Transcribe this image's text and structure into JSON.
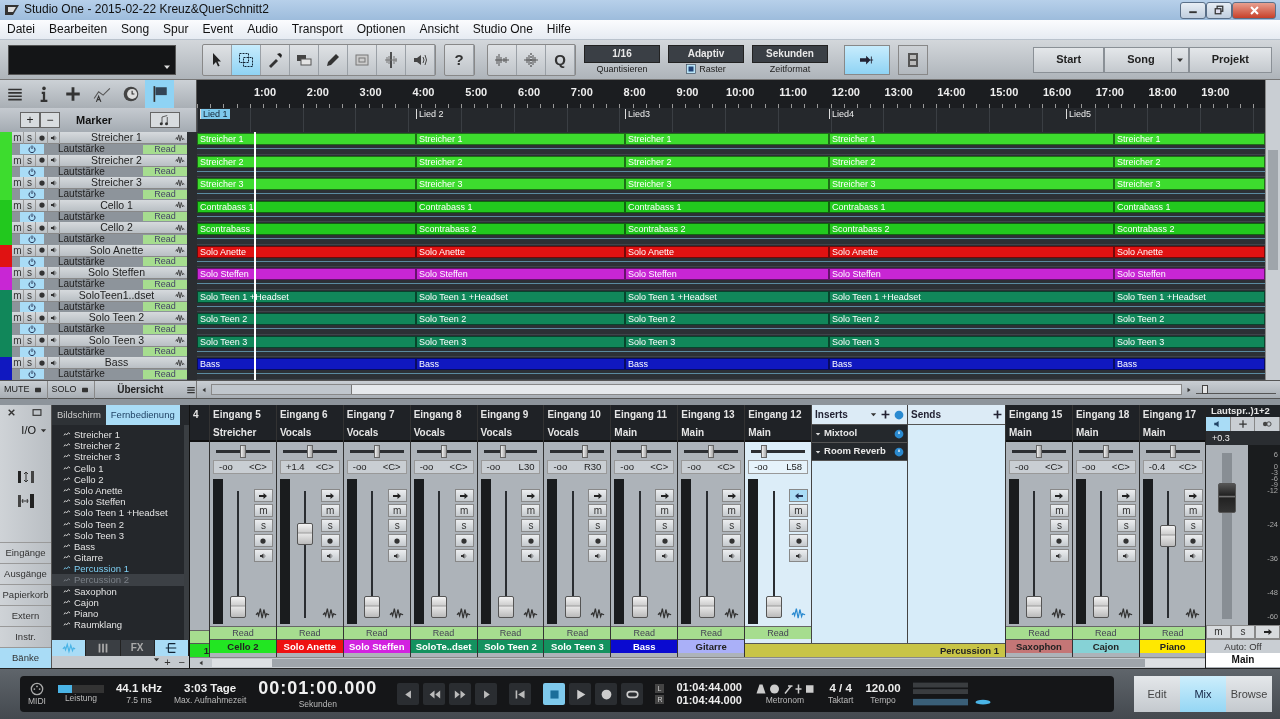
{
  "window": {
    "title": "Studio One - 2015-02-22 Kreuz&QuerSchnitt2"
  },
  "menu": [
    "Datei",
    "Bearbeiten",
    "Song",
    "Spur",
    "Event",
    "Audio",
    "Transport",
    "Optionen",
    "Ansicht",
    "Studio One",
    "Hilfe"
  ],
  "toolbar": {
    "tools": [
      {
        "kind": "pointer",
        "selected": false
      },
      {
        "kind": "range",
        "selected": true
      },
      {
        "kind": "dropper",
        "selected": false
      },
      {
        "kind": "blocks",
        "selected": false
      },
      {
        "kind": "pencil",
        "selected": false
      },
      {
        "kind": "mute",
        "selected": false
      },
      {
        "kind": "split",
        "selected": false
      },
      {
        "kind": "listen",
        "selected": false
      }
    ],
    "help": "?",
    "audio_tools": [
      {
        "kind": "bend"
      },
      {
        "kind": "detect"
      },
      {
        "kind": "text",
        "label": "Q"
      }
    ],
    "quantize": {
      "value": "1/16",
      "label": "Quantisieren"
    },
    "snap": {
      "value": "Adaptiv",
      "label": "Raster",
      "checked": true
    },
    "timeformat": {
      "value": "Sekunden",
      "label": "Zeitformat"
    },
    "follow": {
      "selected": true
    },
    "video": {
      "selected": false
    },
    "pages": [
      {
        "label": "Start",
        "dropdown": false
      },
      {
        "label": "Song",
        "dropdown": true
      },
      {
        "label": "Projekt",
        "dropdown": false
      }
    ]
  },
  "arrange": {
    "view_tools": [
      {
        "kind": "list",
        "selected": false
      },
      {
        "kind": "info",
        "selected": false
      },
      {
        "kind": "plus",
        "selected": false
      },
      {
        "kind": "automation",
        "selected": false
      },
      {
        "kind": "clock",
        "selected": false
      },
      {
        "kind": "flag",
        "selected": true
      }
    ],
    "ruler": [
      "1:00",
      "2:00",
      "3:00",
      "4:00",
      "5:00",
      "6:00",
      "7:00",
      "8:00",
      "9:00",
      "10:00",
      "11:00",
      "12:00",
      "13:00",
      "14:00",
      "15:00",
      "16:00",
      "17:00",
      "18:00",
      "19:00"
    ],
    "marker_buttons": [
      "+",
      "−"
    ],
    "marker_label": "Marker",
    "markers": [
      {
        "label": "Lied 1",
        "selected": true
      },
      {
        "label": "Lied 2",
        "selected": false
      },
      {
        "label": "Lied3",
        "selected": false
      },
      {
        "label": "Lied4",
        "selected": false
      },
      {
        "label": "Lied5",
        "selected": false
      }
    ],
    "tracks": [
      {
        "name": "Streicher 1",
        "color": "#3ddc2e",
        "buttons": [
          "m",
          "s"
        ],
        "automation": "Lautstärke",
        "mode": "Read",
        "clips": [
          "Streicher 1",
          "Streicher 1",
          "Streicher 1",
          "Streicher 1",
          "Streicher 1"
        ]
      },
      {
        "name": "Streicher 2",
        "color": "#3ddc2e",
        "buttons": [
          "m",
          "s"
        ],
        "automation": "Lautstärke",
        "mode": "Read",
        "clips": [
          "Streicher 2",
          "Streicher 2",
          "Streicher 2",
          "Streicher 2",
          "Streicher 2"
        ]
      },
      {
        "name": "Streicher 3",
        "color": "#3ddc2e",
        "buttons": [
          "m",
          "s"
        ],
        "automation": "Lautstärke",
        "mode": "Read",
        "clips": [
          "Streicher 3",
          "Streicher 3",
          "Streicher 3",
          "Streicher 3",
          "Streicher 3"
        ]
      },
      {
        "name": "Cello 1",
        "color": "#22c81e",
        "buttons": [
          "m",
          "s"
        ],
        "automation": "Lautstärke",
        "mode": "Read",
        "clips": [
          "Contrabass 1",
          "Contrabass 1",
          "Contrabass 1",
          "Contrabass 1",
          "Contrabass 1"
        ]
      },
      {
        "name": "Cello 2",
        "color": "#22c81e",
        "buttons": [
          "m",
          "s"
        ],
        "automation": "Lautstärke",
        "mode": "Read",
        "clips": [
          "Scontrabass",
          "Scontrabass 2",
          "Scontrabass 2",
          "Scontrabass 2",
          "Scontrabass 2"
        ]
      },
      {
        "name": "Solo Anette",
        "color": "#e01212",
        "buttons": [
          "m",
          "s"
        ],
        "automation": "Lautstärke",
        "mode": "Read",
        "clips": [
          "Solo Anette",
          "Solo Anette",
          "Solo Anette",
          "Solo Anette",
          "Solo Anette"
        ]
      },
      {
        "name": "Solo Steffen",
        "color": "#c826d4",
        "buttons": [
          "m",
          "s"
        ],
        "automation": "Lautstärke",
        "mode": "Read",
        "clips": [
          "Solo Steffen",
          "Solo Steffen",
          "Solo Steffen",
          "Solo Steffen",
          "Solo Steffen"
        ]
      },
      {
        "name": "SoloTeen1..dset",
        "color": "#11875a",
        "buttons": [
          "m",
          "s"
        ],
        "automation": "Lautstärke",
        "mode": "Read",
        "clips": [
          "Solo Teen 1 +Headset",
          "Solo Teen 1 +Headset",
          "Solo Teen 1 +Headset",
          "Solo Teen 1 +Headset",
          "Solo Teen 1 +Headset"
        ]
      },
      {
        "name": "Solo Teen 2",
        "color": "#11875a",
        "buttons": [
          "m",
          "s"
        ],
        "automation": "Lautstärke",
        "mode": "Read",
        "clips": [
          "Solo Teen 2",
          "Solo Teen 2",
          "Solo Teen 2",
          "Solo Teen 2",
          "Solo Teen 2"
        ]
      },
      {
        "name": "Solo Teen 3",
        "color": "#11875a",
        "buttons": [
          "m",
          "s"
        ],
        "automation": "Lautstärke",
        "mode": "Read",
        "clips": [
          "Solo Teen 3",
          "Solo Teen 3",
          "Solo Teen 3",
          "Solo Teen 3",
          "Solo Teen 3"
        ]
      },
      {
        "name": "Bass",
        "color": "#1018c0",
        "buttons": [
          "m",
          "s"
        ],
        "automation": "Lautstärke",
        "mode": "Read",
        "clips": [
          "Bass",
          "Bass",
          "Bass",
          "Bass",
          "Bass"
        ]
      }
    ],
    "footer": {
      "mute": "MUTE",
      "solo": "SOLO",
      "overview": "Übersicht"
    },
    "zoom": {
      "level": 0.08
    }
  },
  "mixer": {
    "side": {
      "io": "I/O",
      "buttons": [
        {
          "label": "Eingänge",
          "selected": false
        },
        {
          "label": "Ausgänge",
          "selected": false
        },
        {
          "label": "Papierkorb",
          "selected": false
        },
        {
          "label": "Extern",
          "selected": false
        },
        {
          "label": "Instr.",
          "selected": false
        },
        {
          "label": "Bänke",
          "selected": true
        }
      ]
    },
    "browser": {
      "tabs": [
        {
          "label": "Bildschirm",
          "selected": false
        },
        {
          "label": "Fernbedienung",
          "selected": true
        }
      ],
      "items": [
        {
          "label": "Streicher 1",
          "selected": false,
          "active": false
        },
        {
          "label": "Streicher 2",
          "selected": false,
          "active": false
        },
        {
          "label": "Streicher 3",
          "selected": false,
          "active": false
        },
        {
          "label": "Cello 1",
          "selected": false,
          "active": false
        },
        {
          "label": "Cello 2",
          "selected": false,
          "active": false
        },
        {
          "label": "Solo Anette",
          "selected": false,
          "active": false
        },
        {
          "label": "Solo Steffen",
          "selected": false,
          "active": false
        },
        {
          "label": "Solo Teen 1 +Headset",
          "selected": false,
          "active": false
        },
        {
          "label": "Solo Teen 2",
          "selected": false,
          "active": false
        },
        {
          "label": "Solo Teen 3",
          "selected": false,
          "active": false
        },
        {
          "label": "Bass",
          "selected": false,
          "active": false
        },
        {
          "label": "Gitarre",
          "selected": false,
          "active": false
        },
        {
          "label": "Percussion 1",
          "selected": false,
          "active": true
        },
        {
          "label": "Percussion 2",
          "selected": true,
          "active": false
        },
        {
          "label": "Saxophon",
          "selected": false,
          "active": false
        },
        {
          "label": "Cajon",
          "selected": false,
          "active": false
        },
        {
          "label": "Piano",
          "selected": false,
          "active": false
        },
        {
          "label": "Raumklang",
          "selected": false,
          "active": false
        }
      ],
      "bottom_tabs": [
        {
          "kind": "wave",
          "selected": true
        },
        {
          "kind": "bars",
          "selected": false
        },
        {
          "kind": "text",
          "label": "FX",
          "selected": false
        },
        {
          "kind": "bank",
          "selected": true
        }
      ],
      "controls": [
        "+",
        "−"
      ]
    },
    "strips": [
      {
        "kind": "partial",
        "input": "4",
        "name": "1",
        "color": "#22dd22"
      },
      {
        "kind": "channel",
        "input": "Eingang 5",
        "output": "Streicher",
        "volume": "-oo",
        "pan": {
          "reading": "<C>",
          "level": 0.5
        },
        "fader": {
          "level": 0
        },
        "buttons": [
          "m",
          "s"
        ],
        "automation": "Read",
        "name": "Cello 2",
        "color": "#22e622",
        "selected": false
      },
      {
        "kind": "channel",
        "input": "Eingang 6",
        "output": "Vocals",
        "volume": "+1.4",
        "pan": {
          "reading": "<C>",
          "level": 0.5
        },
        "fader": {
          "level": 0.7
        },
        "buttons": [
          "m",
          "s"
        ],
        "automation": "Read",
        "name": "Solo Anette",
        "color": "#ee1111",
        "selected": false
      },
      {
        "kind": "channel",
        "input": "Eingang 7",
        "output": "Vocals",
        "volume": "-oo",
        "pan": {
          "reading": "<C>",
          "level": 0.5
        },
        "fader": {
          "level": 0
        },
        "buttons": [
          "m",
          "s"
        ],
        "automation": "Read",
        "name": "Solo Steffen",
        "color": "#d222e0",
        "selected": false
      },
      {
        "kind": "channel",
        "input": "Eingang 8",
        "output": "Vocals",
        "volume": "-oo",
        "pan": {
          "reading": "<C>",
          "level": 0.5
        },
        "fader": {
          "level": 0
        },
        "buttons": [
          "m",
          "s"
        ],
        "automation": "Read",
        "name": "SoloTe..dset",
        "color": "#13925f",
        "selected": false
      },
      {
        "kind": "channel",
        "input": "Eingang 9",
        "output": "Vocals",
        "volume": "-oo",
        "pan": {
          "reading": "L30",
          "level": 0.35
        },
        "fader": {
          "level": 0
        },
        "buttons": [
          "m",
          "s"
        ],
        "automation": "Read",
        "name": "Solo Teen 2",
        "color": "#13925f",
        "selected": false
      },
      {
        "kind": "channel",
        "input": "Eingang 10",
        "output": "Vocals",
        "volume": "-oo",
        "pan": {
          "reading": "R30",
          "level": 0.65
        },
        "fader": {
          "level": 0
        },
        "buttons": [
          "m",
          "s"
        ],
        "automation": "Read",
        "name": "Solo Teen 3",
        "color": "#13925f",
        "selected": false
      },
      {
        "kind": "channel",
        "input": "Eingang 11",
        "output": "Main",
        "volume": "-oo",
        "pan": {
          "reading": "<C>",
          "level": 0.5
        },
        "fader": {
          "level": 0
        },
        "buttons": [
          "m",
          "s"
        ],
        "automation": "Read",
        "name": "Bass",
        "color": "#0a0ad0",
        "selected": false
      },
      {
        "kind": "channel",
        "input": "Eingang 13",
        "output": "Main",
        "volume": "-oo",
        "pan": {
          "reading": "<C>",
          "level": 0.5
        },
        "fader": {
          "level": 0
        },
        "buttons": [
          "m",
          "s"
        ],
        "automation": "Read",
        "name": "Gitarre",
        "color": "#aab0f8",
        "selected": false
      },
      {
        "kind": "channel",
        "input": "Eingang 12",
        "output": "Main",
        "volume": "-oo",
        "pan": {
          "reading": "L58",
          "level": 0.2
        },
        "fader": {
          "level": 0
        },
        "buttons": [
          "m",
          "s"
        ],
        "automation": "Read",
        "name": "Percussion 1",
        "color": "#c8c446",
        "selected": true,
        "inserts": {
          "label": "Inserts",
          "items": [
            {
              "label": "Mixtool",
              "on": true
            },
            {
              "label": "Room Reverb",
              "on": true
            }
          ]
        },
        "sends": {
          "label": "Sends"
        }
      },
      {
        "kind": "channel",
        "input": "Eingang 15",
        "output": "Main",
        "volume": "-oo",
        "pan": {
          "reading": "<C>",
          "level": 0.5
        },
        "fader": {
          "level": 0
        },
        "buttons": [
          "m",
          "s"
        ],
        "automation": "Read",
        "name": "Saxophon",
        "color": "#c47676",
        "selected": false
      },
      {
        "kind": "channel",
        "input": "Eingang 18",
        "output": "Main",
        "volume": "-oo",
        "pan": {
          "reading": "<C>",
          "level": 0.5
        },
        "fader": {
          "level": 0
        },
        "buttons": [
          "m",
          "s"
        ],
        "automation": "Read",
        "name": "Cajon",
        "color": "#86d2d6",
        "selected": false
      },
      {
        "kind": "channel",
        "input": "Eingang 17",
        "output": "Main",
        "volume": "-0.4",
        "pan": {
          "reading": "<C>",
          "level": 0.5
        },
        "fader": {
          "level": 0.68
        },
        "buttons": [
          "m",
          "s"
        ],
        "automation": "Read",
        "name": "Piano",
        "color": "#ffe800",
        "selected": false
      }
    ],
    "main": {
      "output": "Lautspr..)1+2",
      "volume": "+0.3",
      "fader": {
        "level": 0.78
      },
      "scale": [
        "6",
        "0",
        "-3",
        "-6",
        "-9",
        "-12",
        "-24",
        "-36",
        "-48",
        "-60"
      ],
      "buttons": [
        "m",
        "s"
      ],
      "automation": "Auto: Off",
      "name": "Main"
    }
  },
  "transport": {
    "midi": "MIDI",
    "performance": "Leistung",
    "sample_rate": "44.1 kHz",
    "latency": "7.5 ms",
    "rec_time": "3:03 Tage",
    "rec_time_label": "Max. Aufnahmezeit",
    "time": "00:01:00.000",
    "time_label": "Sekunden",
    "buttons": [
      {
        "kind": "prev",
        "selected": false
      },
      {
        "kind": "rewind",
        "selected": false
      },
      {
        "kind": "forward",
        "selected": false
      },
      {
        "kind": "next",
        "selected": false
      },
      {
        "kind": "to-start",
        "selected": false
      },
      {
        "kind": "stop",
        "selected": true
      },
      {
        "kind": "play",
        "selected": false
      },
      {
        "kind": "record",
        "selected": false
      },
      {
        "kind": "loop",
        "selected": false
      }
    ],
    "loop_markers": [
      "L",
      "R"
    ],
    "loop_start": "01:04:44.000",
    "loop_end": "01:04:44.000",
    "metronome_label": "Metronom",
    "signature": "4 / 4",
    "signature_label": "Taktart",
    "tempo": "120.00",
    "tempo_label": "Tempo",
    "views": [
      {
        "label": "Edit",
        "selected": false
      },
      {
        "label": "Mix",
        "selected": true
      },
      {
        "label": "Browse",
        "selected": false
      }
    ]
  }
}
